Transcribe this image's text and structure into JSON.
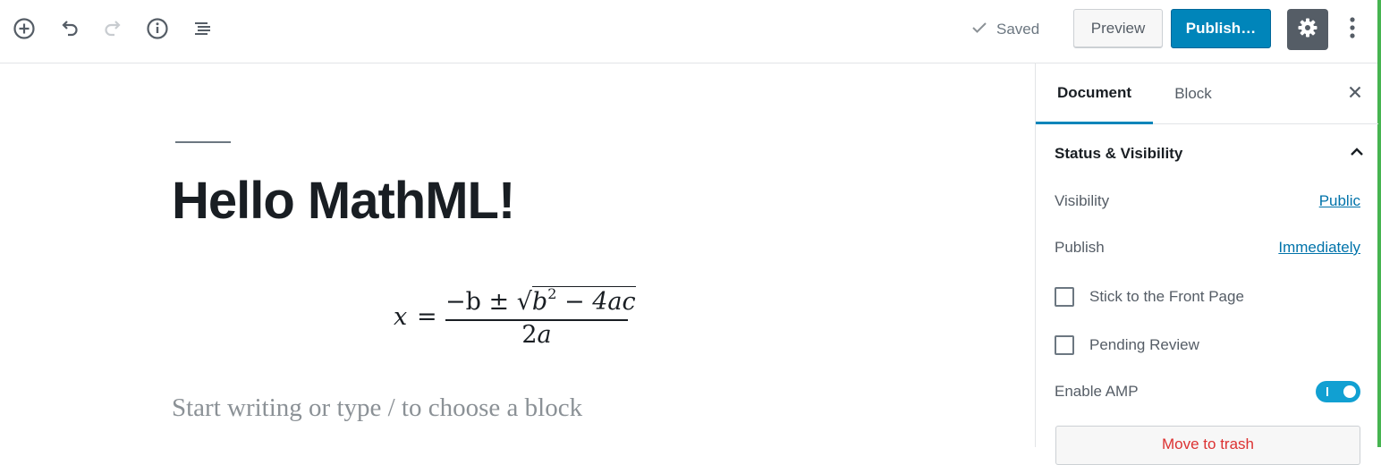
{
  "header": {
    "saved_label": "Saved",
    "preview_label": "Preview",
    "publish_label": "Publish…"
  },
  "editor": {
    "post_title": "Hello MathML!",
    "formula": {
      "lhs": "x",
      "eq": "=",
      "num_before_sqrt": "−b ± ",
      "radicand_base": "b",
      "radicand_exp": "2",
      "radicand_rest": " − 4ac",
      "den_coef": "2",
      "den_var": "a"
    },
    "placeholder": "Start writing or type / to choose a block"
  },
  "sidebar": {
    "tabs": [
      {
        "label": "Document",
        "active": true
      },
      {
        "label": "Block",
        "active": false
      }
    ],
    "panel_title": "Status & Visibility",
    "visibility_label": "Visibility",
    "visibility_value": "Public",
    "publish_label": "Publish",
    "publish_value": "Immediately",
    "stick_label": "Stick to the Front Page",
    "pending_label": "Pending Review",
    "amp_label": "Enable AMP",
    "amp_enabled": true,
    "trash_label": "Move to trash"
  },
  "colors": {
    "primary": "#0085ba",
    "link": "#0073aa",
    "toggle_on": "#11a0d2",
    "danger": "#dc3232",
    "edge_green": "#46b450"
  },
  "icons": [
    "add-block-icon",
    "undo-icon",
    "redo-icon",
    "info-icon",
    "outline-icon",
    "check-icon",
    "gear-icon",
    "more-vertical-icon",
    "close-icon",
    "chevron-up-icon"
  ]
}
